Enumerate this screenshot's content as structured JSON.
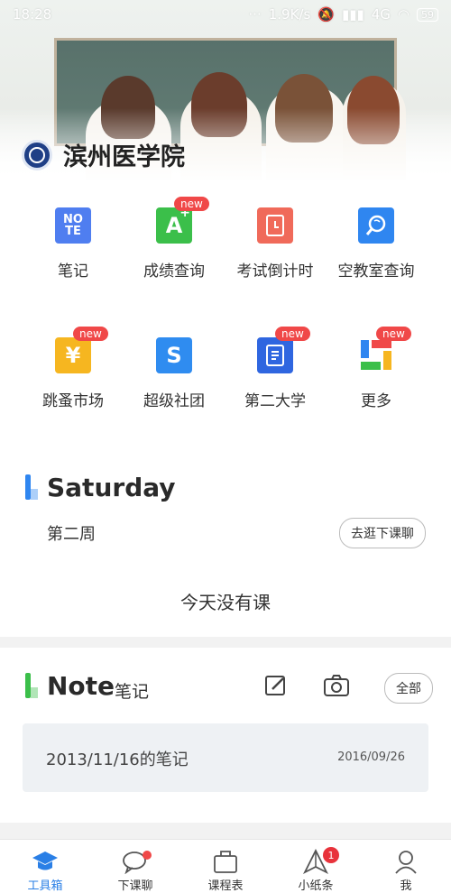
{
  "status_bar": {
    "time": "18:28",
    "speed": "1.9K/s",
    "network": "4G",
    "battery": "59"
  },
  "header": {
    "school_name": "滨州医学院"
  },
  "tools": [
    {
      "label": "笔记",
      "icon": "note-icon",
      "icon_text": "NO\nTE",
      "color": "#4f7ef0",
      "new": false
    },
    {
      "label": "成绩查询",
      "icon": "grade-icon",
      "icon_text": "A",
      "color": "#3bbf4a",
      "new": true,
      "new_label": "new"
    },
    {
      "label": "考试倒计时",
      "icon": "countdown-icon",
      "icon_text": "",
      "color": "#f06a5a",
      "new": false
    },
    {
      "label": "空教室查询",
      "icon": "classroom-search-icon",
      "icon_text": "",
      "color": "#2f86f0",
      "new": false
    },
    {
      "label": "跳蚤市场",
      "icon": "market-icon",
      "icon_text": "¥",
      "color": "#f6b620",
      "new": true,
      "new_label": "new"
    },
    {
      "label": "超级社团",
      "icon": "club-icon",
      "icon_text": "S",
      "color": "#2f8cf0",
      "new": false
    },
    {
      "label": "第二大学",
      "icon": "book-icon",
      "icon_text": "",
      "color": "#2f66e0",
      "new": true,
      "new_label": "new"
    },
    {
      "label": "更多",
      "icon": "more-icon",
      "icon_text": "",
      "color": "#ffffff",
      "new": true,
      "new_label": "new"
    }
  ],
  "schedule": {
    "day": "Saturday",
    "week": "第二周",
    "chip": "去逛下课聊",
    "empty_message": "今天没有课"
  },
  "notes": {
    "title": "Note",
    "subtitle": "笔记",
    "all_label": "全部",
    "item": {
      "title": "2013/11/16的笔记",
      "date": "2016/09/26"
    }
  },
  "nav": [
    {
      "label": "工具箱",
      "icon": "toolbox-icon",
      "active": true
    },
    {
      "label": "下课聊",
      "icon": "chat-icon",
      "dot": true
    },
    {
      "label": "课程表",
      "icon": "timetable-icon"
    },
    {
      "label": "小纸条",
      "icon": "paper-plane-icon",
      "badge": "1"
    },
    {
      "label": "我",
      "icon": "profile-icon"
    }
  ],
  "colors": {
    "accent": "#2a7fe6",
    "badge": "#f04848"
  }
}
